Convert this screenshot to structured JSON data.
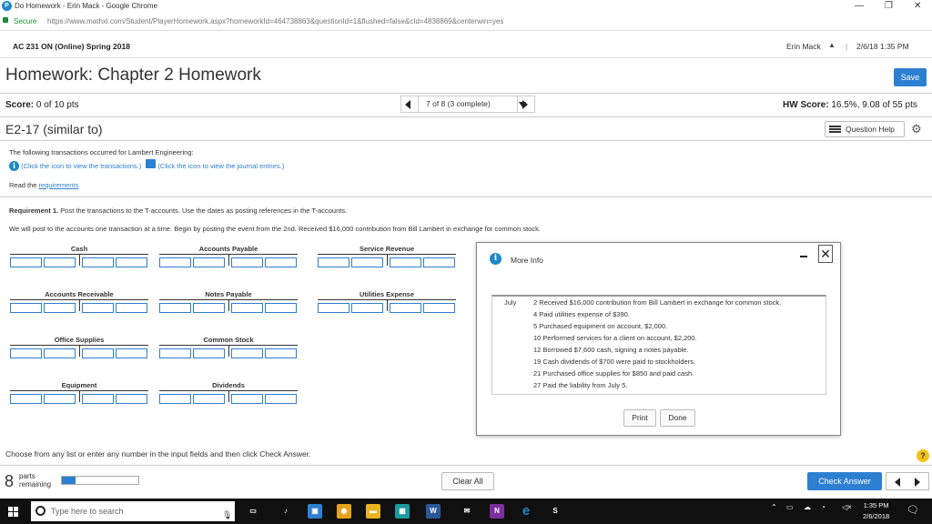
{
  "browser": {
    "tab_title": "Do Homework - Erin Mack - Google Chrome",
    "secure_label": "Secure",
    "url": "https://www.mathxl.com/Student/PlayerHomework.aspx?homeworkId=464738863&questionId=1&flushed=false&cId=4838869&centerwin=yes",
    "minimize": "—",
    "maximize": "❐",
    "close": "✕"
  },
  "course": {
    "name": "AC 231 ON (Online) Spring 2018",
    "user": "Erin Mack",
    "user_icon": "▲",
    "separator": "|",
    "datetime": "2/6/18 1:35 PM"
  },
  "homework": {
    "title": "Homework: Chapter 2 Homework",
    "save_label": "Save",
    "score_label": "Score:",
    "score_value": "0 of 10 pts",
    "nav_text": "7 of 8 (3 complete)",
    "hw_score_label": "HW Score:",
    "hw_score_value": "16.5%, 9.08 of 55 pts",
    "question_id": "E2-17 (similar to)",
    "question_help": "Question Help"
  },
  "question": {
    "intro": "The following transactions occurred for Lambert Engineering:",
    "info_link_1": "(Click the icon to view the transactions.)",
    "info_link_2": "(Click the icon to view the journal entries.)",
    "read_the": "Read the",
    "requirements_link": "requirements",
    "req_label": "Requirement 1.",
    "req_text": "Post the transactions to the T-accounts. Use the dates as posting references in the T-accounts.",
    "instruction": "We will post to the accounts one transaction at a time. Begin by posting the event from the 2nd. Received $16,000 contribution from Bill Lambert in exchange for common stock."
  },
  "t_accounts": [
    {
      "name": "Cash"
    },
    {
      "name": "Accounts Payable"
    },
    {
      "name": "Service Revenue"
    },
    {
      "name": "Accounts Receivable"
    },
    {
      "name": "Notes Payable"
    },
    {
      "name": "Utilities Expense"
    },
    {
      "name": "Office Supplies"
    },
    {
      "name": "Common Stock"
    },
    {
      "name": "Equipment"
    },
    {
      "name": "Dividends"
    }
  ],
  "dialog": {
    "title": "More Info",
    "minimize": "",
    "close": "✕",
    "month": "July",
    "rows": [
      "2 Received $16,000 contribution from Bill Lambert in exchange for common stock.",
      "4 Paid utilities expense of $390.",
      "5 Purchased equipment on account, $2,000.",
      "10 Performed services for a client on account, $2,200.",
      "12 Borrowed $7,600 cash, signing a notes payable.",
      "19 Cash dividends of $700 were paid to stockholders.",
      "21 Purchased office supplies for $850 and paid cash.",
      "27 Paid the liability from July 5."
    ],
    "print_label": "Print",
    "done_label": "Done"
  },
  "footer": {
    "instruction": "Choose from any list or enter any number in the input fields and then click Check Answer.",
    "help": "?",
    "parts_count": "8",
    "parts_label_1": "parts",
    "parts_label_2": "remaining",
    "progress_fraction": 0.18,
    "clear_label": "Clear All",
    "check_label": "Check Answer"
  },
  "taskbar": {
    "search_placeholder": "Type here to search",
    "time": "1:35 PM",
    "date": "2/6/2018",
    "app_icons": [
      "task-view-icon",
      "media-icon",
      "store-icon",
      "chrome-icon",
      "file-explorer-icon",
      "calculator-icon",
      "word-icon",
      "mail-icon",
      "onenote-icon",
      "edge-icon",
      "skype-icon"
    ],
    "colors": {
      "chrome": "#e8a21a",
      "word": "#2b5797",
      "onenote": "#7b2e9e",
      "edge": "#1e88c8",
      "store": "#2d7fd1"
    }
  }
}
